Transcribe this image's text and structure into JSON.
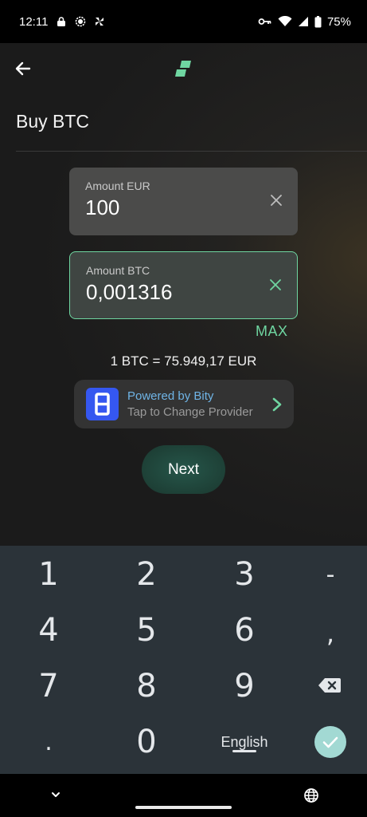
{
  "status_bar": {
    "time": "12:11",
    "battery": "75%",
    "left_icons": [
      "lock-icon",
      "signal-app-icon",
      "pinwheel-icon"
    ],
    "right_icons": [
      "key-icon",
      "wifi-icon",
      "cell-signal-icon",
      "battery-icon"
    ]
  },
  "header": {
    "title": "Buy BTC",
    "logo": "exchange-logo-icon",
    "back_icon": "back-arrow-icon"
  },
  "form": {
    "eur": {
      "label": "Amount EUR",
      "value": "100"
    },
    "btc": {
      "label": "Amount BTC",
      "value": "0,001316"
    },
    "max_label": "MAX"
  },
  "rate": "1 BTC = 75.949,17 EUR",
  "provider": {
    "line1": "Powered by Bity",
    "line2": "Tap to Change Provider",
    "logo_letter": "B"
  },
  "next_label": "Next",
  "keyboard": {
    "row1": [
      "1",
      "2",
      "3",
      "-"
    ],
    "row2": [
      "4",
      "5",
      "6",
      ","
    ],
    "row3": [
      "7",
      "8",
      "9"
    ],
    "row4": [
      ".",
      "0"
    ],
    "language": "English"
  },
  "colors": {
    "accent": "#6fd6a1",
    "link": "#6fb4e6",
    "bity": "#3557f0",
    "next_button": "#1e4137",
    "keyboard_bg": "#2b3339",
    "enter_key": "#a2d9d3"
  }
}
